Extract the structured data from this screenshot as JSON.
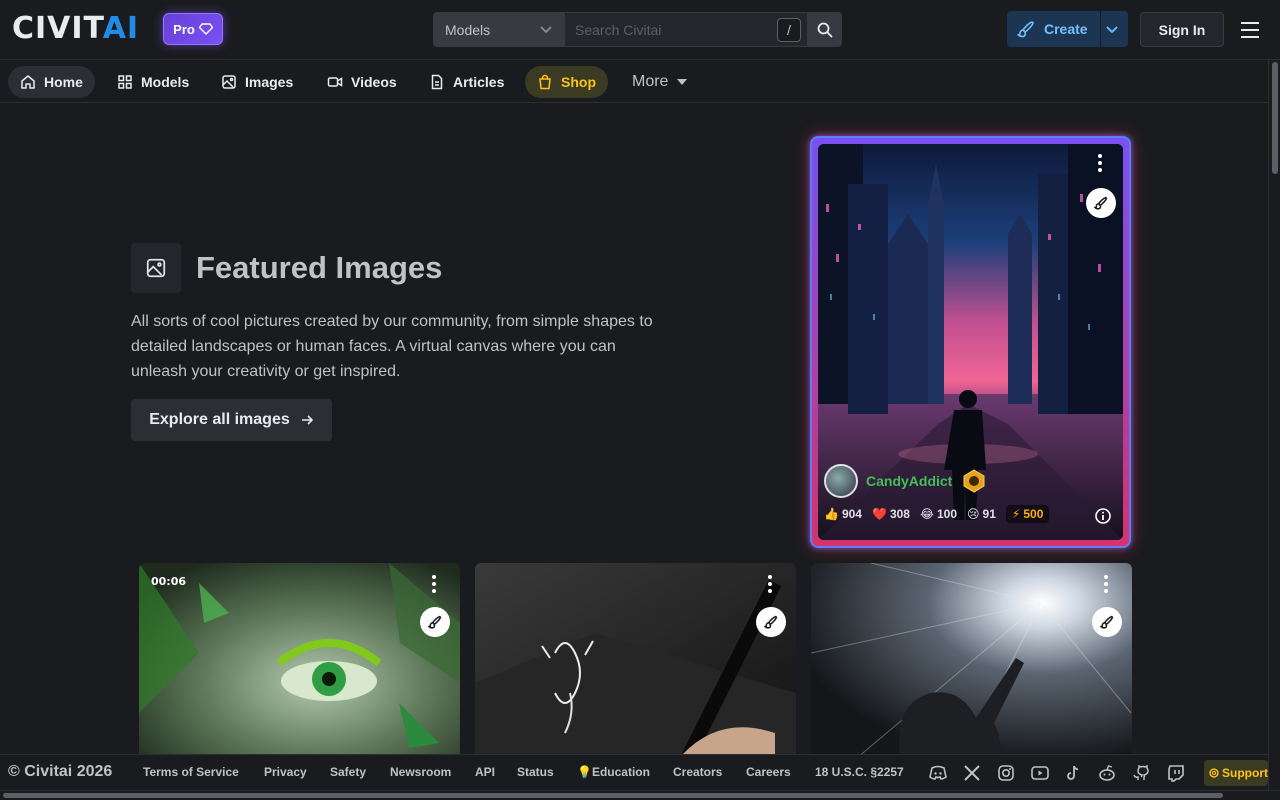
{
  "header": {
    "logo_main": "CIVIT",
    "logo_accent": "AI",
    "pro_label": "Pro",
    "search_category": "Models",
    "search_placeholder": "Search Civitai",
    "search_shortcut": "/",
    "create_label": "Create",
    "signin_label": "Sign In"
  },
  "nav": {
    "items": [
      {
        "label": "Home",
        "icon": "home-icon"
      },
      {
        "label": "Models",
        "icon": "grid-icon"
      },
      {
        "label": "Images",
        "icon": "image-icon"
      },
      {
        "label": "Videos",
        "icon": "video-icon"
      },
      {
        "label": "Articles",
        "icon": "article-icon"
      },
      {
        "label": "Shop",
        "icon": "shopping-bag-icon"
      }
    ],
    "more_label": "More",
    "active": "Home"
  },
  "featured": {
    "title": "Featured Images",
    "description": "All sorts of cool pictures created by our community, from simple shapes to detailed landscapes or human faces. A virtual canvas where you can unleash your creativity or get inspired.",
    "explore_label": "Explore all images"
  },
  "hero_card": {
    "username": "CandyAddict",
    "reactions": {
      "like": "904",
      "heart": "308",
      "laugh": "100",
      "cry": "91"
    },
    "buzz": "500"
  },
  "thumbnails": [
    {
      "duration": "00:06"
    },
    {
      "duration": ""
    },
    {
      "duration": ""
    }
  ],
  "footer": {
    "copyright": "© Civitai 2026",
    "links": [
      "Terms of Service",
      "Privacy",
      "Safety",
      "Newsroom",
      "API",
      "Status",
      "Education",
      "Creators",
      "Careers",
      "18 U.S.C. §2257"
    ],
    "education_icon": "lightbulb-icon",
    "support_label": "Support",
    "social": [
      "discord-icon",
      "x-icon",
      "instagram-icon",
      "youtube-icon",
      "tiktok-icon",
      "reddit-icon",
      "github-icon",
      "twitch-icon"
    ]
  },
  "colors": {
    "background": "#1a1b1e",
    "accent_blue": "#228be6",
    "shop_yellow": "#fcc419",
    "username_green": "#40c057",
    "pro_purple": "#7950f2"
  }
}
